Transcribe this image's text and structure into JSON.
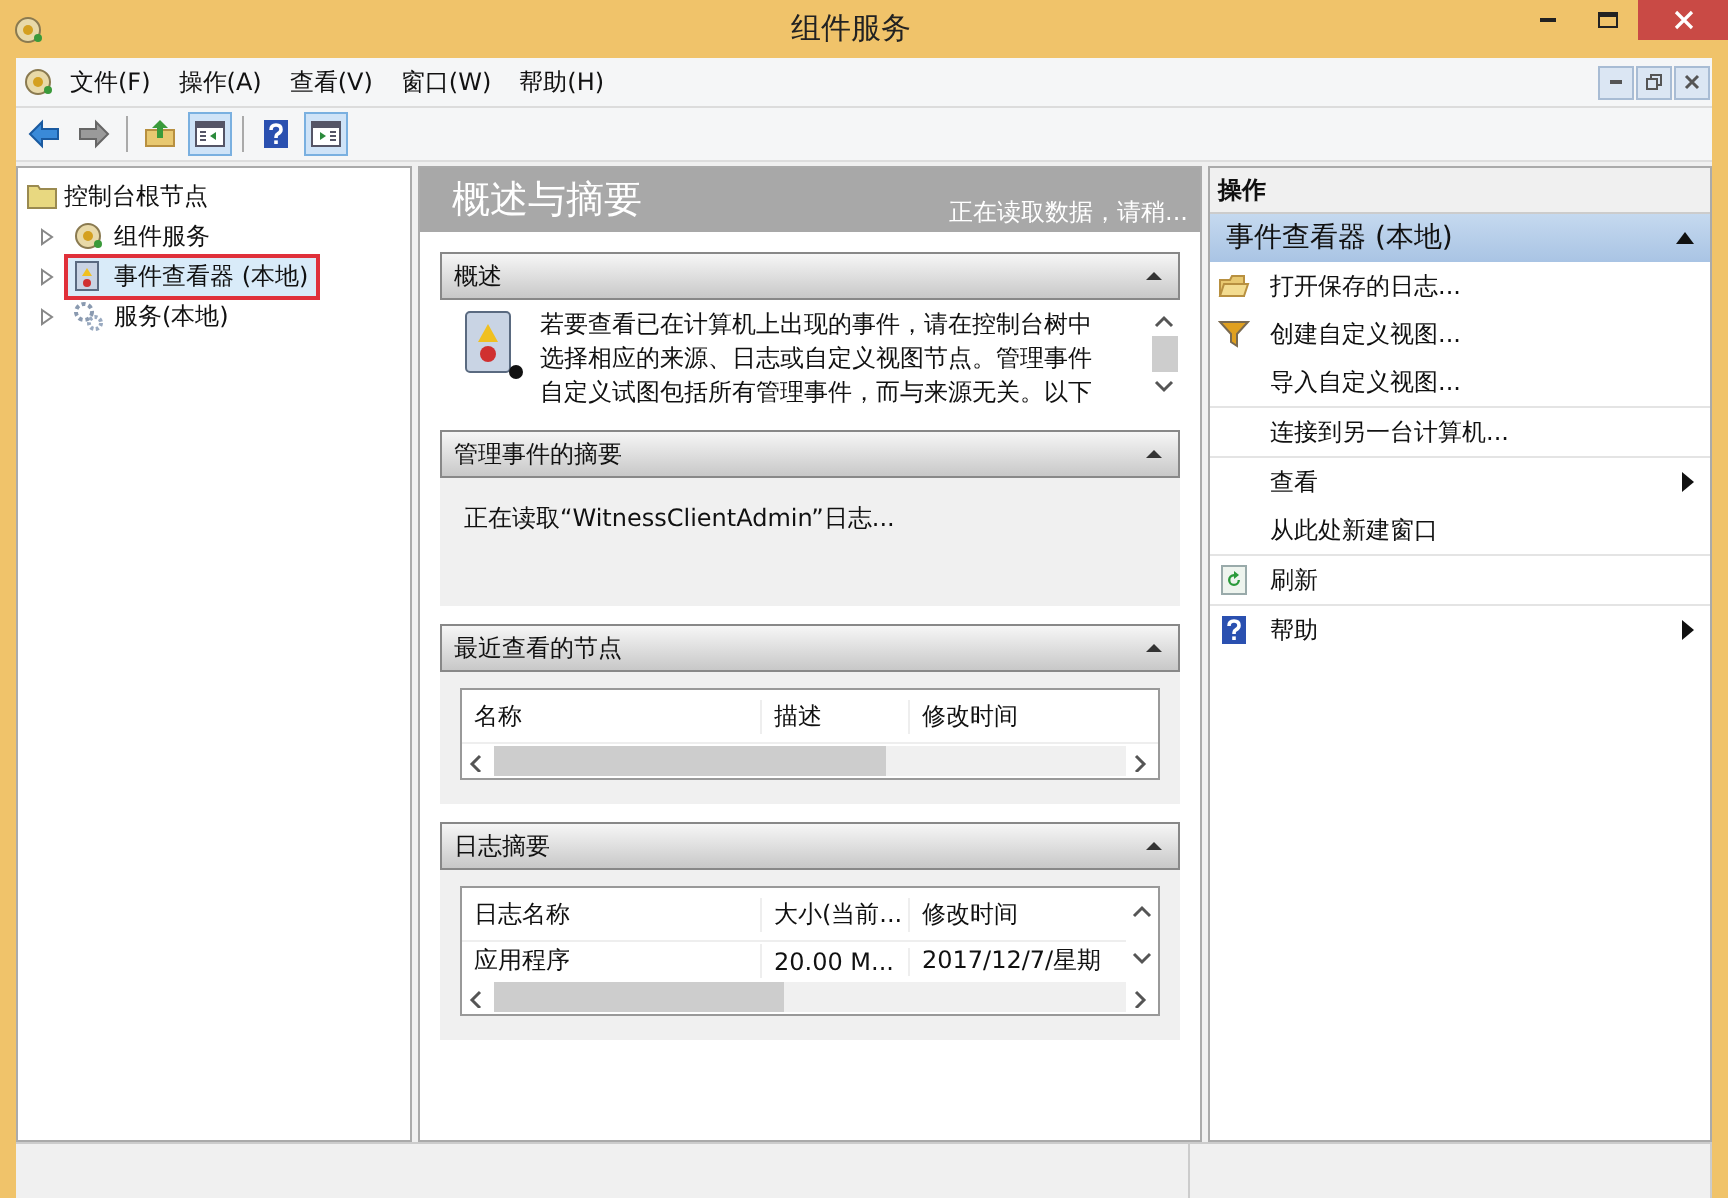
{
  "window": {
    "title": "组件服务"
  },
  "menu": [
    "文件(F)",
    "操作(A)",
    "查看(V)",
    "窗口(W)",
    "帮助(H)"
  ],
  "toolbar": [
    {
      "kind": "back"
    },
    {
      "kind": "forward"
    },
    {
      "kind": "sep"
    },
    {
      "kind": "up"
    },
    {
      "kind": "pane",
      "selected": true
    },
    {
      "kind": "sep"
    },
    {
      "kind": "help"
    },
    {
      "kind": "pane2",
      "selected": true
    }
  ],
  "tree": {
    "label": "控制台根节点",
    "children": [
      {
        "label": "组件服务",
        "kind": "component",
        "selected": false,
        "marked": false
      },
      {
        "label": "事件查看器 (本地)",
        "kind": "eventlog",
        "selected": true,
        "marked": true
      },
      {
        "label": "服务(本地)",
        "kind": "services",
        "selected": false,
        "marked": false
      }
    ]
  },
  "center": {
    "title": "概述与摘要",
    "status": "正在读取数据，请稍...",
    "sections": [
      {
        "kind": "text",
        "title": "概述",
        "expanded": true,
        "lines": [
          "若要查看已在计算机上出现的事件，请在控制台树中",
          "选择相应的来源、日志或自定义视图节点。管理事件",
          "自定义试图包括所有管理事件，而与来源无关。以下"
        ]
      },
      {
        "kind": "message",
        "title": "管理事件的摘要",
        "expanded": true,
        "text": "正在读取“WitnessClientAdmin”日志..."
      },
      {
        "kind": "table",
        "title": "最近查看的节点",
        "expanded": true,
        "columns": [
          "名称",
          "描述",
          "修改时间"
        ]
      },
      {
        "kind": "table",
        "title": "日志摘要",
        "expanded": true,
        "columns": [
          "日志名称",
          "大小(当前...",
          "修改时间"
        ],
        "rows": [
          [
            "应用程序",
            "20.00 M...",
            "2017/12/7/星期"
          ]
        ]
      }
    ]
  },
  "actions": {
    "header": "操作",
    "group": {
      "title": "事件查看器 (本地)",
      "expanded": true
    },
    "items": [
      {
        "label": "打开保存的日志...",
        "kind": "folder",
        "submenu": false,
        "divider": false
      },
      {
        "label": "创建自定义视图...",
        "kind": "filter",
        "submenu": false,
        "divider": false
      },
      {
        "label": "导入自定义视图...",
        "kind": "plain",
        "submenu": false,
        "divider": true
      },
      {
        "label": "连接到另一台计算机...",
        "kind": "plain",
        "submenu": false,
        "divider": true
      },
      {
        "label": "查看",
        "kind": "plain",
        "submenu": true,
        "divider": false
      },
      {
        "label": "从此处新建窗口",
        "kind": "plain",
        "submenu": false,
        "divider": true
      },
      {
        "label": "刷新",
        "kind": "refresh",
        "submenu": false,
        "divider": true
      },
      {
        "label": "帮助",
        "kind": "help",
        "submenu": true,
        "divider": false
      }
    ]
  }
}
